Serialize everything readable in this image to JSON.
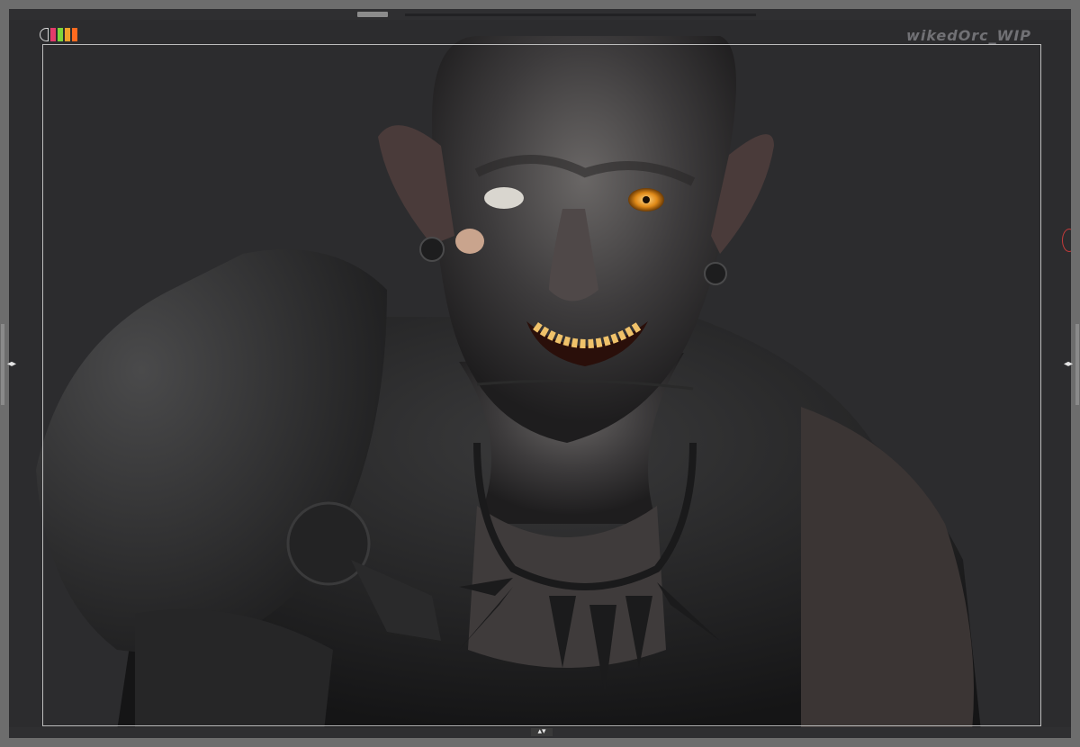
{
  "document": {
    "title": "wikedOrc_WIP"
  },
  "colors": {
    "frame": "#2a2a2c",
    "canvas": "#2c2c2e",
    "chips": [
      "#e23b6b",
      "#7dd63b",
      "#f0a02b",
      "#ff6a1f"
    ]
  },
  "navigation": {
    "left_arrow": "◂▸",
    "right_arrow": "◂▸",
    "bottom_arrow": "▴▾"
  },
  "model": {
    "subject": "orc-bust-sculpt-icon"
  }
}
